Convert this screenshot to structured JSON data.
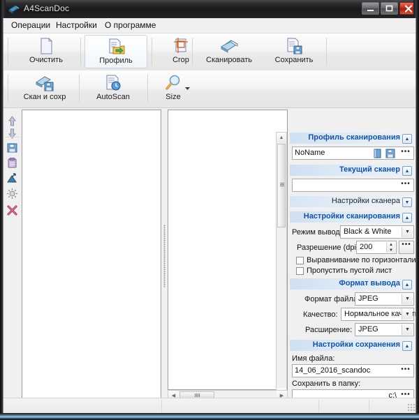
{
  "window": {
    "title": "A4ScanDoc",
    "app_icon": "scanner-icon",
    "buttons": {
      "minimize": "–",
      "maximize": "□",
      "close": "✕"
    }
  },
  "menubar": {
    "items": [
      {
        "label": "Операции",
        "name": "menu-operations"
      },
      {
        "label": "Настройки",
        "name": "menu-settings"
      },
      {
        "label": "О программе",
        "name": "menu-about"
      }
    ]
  },
  "toolbar_top": {
    "buttons": [
      {
        "label": "Очистить",
        "icon": "blank-page-icon",
        "framed": false
      },
      {
        "label": "Профиль",
        "icon": "profile-folder-icon",
        "framed": true
      },
      {
        "label": "Crop",
        "icon": "crop-icon",
        "framed": false
      },
      {
        "label": "Сканировать",
        "icon": "scanner-icon",
        "framed": false
      },
      {
        "label": "Сохранить",
        "icon": "save-document-icon",
        "framed": false
      }
    ]
  },
  "toolbar_bottom": {
    "buttons": [
      {
        "label": "Скан и сохр",
        "icon": "scan-and-save-icon",
        "framed": false
      },
      {
        "label": "AutoScan",
        "icon": "autoscan-icon",
        "framed": false
      },
      {
        "label": "Size",
        "icon": "magnifier-icon",
        "framed": false
      }
    ],
    "dropdown_arrow": "▼"
  },
  "left_tools": {
    "buttons": [
      {
        "name": "move-up-button",
        "icon": "arrow-up-icon"
      },
      {
        "name": "move-down-button",
        "icon": "arrow-down-icon"
      },
      {
        "name": "save-page-button",
        "icon": "floppy-icon"
      },
      {
        "name": "copy-clipboard-button",
        "icon": "clipboard-icon"
      },
      {
        "name": "rotate-button",
        "icon": "rotate-icon"
      },
      {
        "name": "brightness-button",
        "icon": "brightness-icon"
      },
      {
        "name": "delete-button",
        "icon": "delete-x-icon"
      }
    ]
  },
  "thumb_toolbar": {
    "buttons": [
      {
        "name": "select-all-button",
        "icon": "checked-box-icon"
      },
      {
        "name": "deselect-all-button",
        "icon": "empty-box-icon"
      },
      {
        "name": "thumbnail-grid-button",
        "icon": "grid-icon"
      }
    ]
  },
  "preview_toolbar": {
    "buttons": [
      {
        "name": "fit-page-button",
        "icon": "fit-page-icon"
      },
      {
        "name": "fit-left-half-button",
        "icon": "fit-left-half-icon"
      },
      {
        "name": "fit-right-half-button",
        "icon": "fit-right-half-icon"
      },
      {
        "name": "fit-width-button",
        "icon": "fit-width-icon"
      },
      {
        "name": "zoom-actual-button",
        "icon": "zoom-actual-icon"
      },
      {
        "name": "zoom-fit-button",
        "icon": "zoom-fit-icon"
      }
    ]
  },
  "scrollbars": {
    "up_arrow": "▲",
    "down_arrow": "▼",
    "left_arrow": "◀",
    "right_arrow": "▶"
  },
  "right_panel": {
    "profile_section": {
      "title": "Профиль сканирования",
      "toggle": "▲",
      "value": "NoName",
      "open_icon": "open-profile-icon",
      "save_icon": "save-profile-icon",
      "browse": "•••"
    },
    "scanner_section": {
      "title": "Текущий сканер",
      "toggle": "▲",
      "value": "",
      "browse": "•••"
    },
    "scanner_settings_section": {
      "title": "Настройки сканера",
      "toggle": "▼"
    },
    "scan_settings_section": {
      "title": "Настройки сканирования",
      "toggle": "▲",
      "mode_label": "Режим вывода:",
      "mode_value": "Black & White",
      "dpi_label": "Разрешение (dpi):",
      "dpi_value": "200",
      "dpi_browse": "•••",
      "check_align_label": "Выравнивание по горизонтали",
      "check_align_checked": false,
      "check_skip_label": "Пропустить пустой лист",
      "check_skip_checked": false
    },
    "output_section": {
      "title": "Формат вывода",
      "toggle": "▲",
      "file_format_label": "Формат файла:",
      "file_format_value": "JPEG",
      "quality_label": "Качество:",
      "quality_value": "Нормальное качество",
      "extension_label": "Расширение:",
      "extension_value": "JPEG"
    },
    "save_section": {
      "title": "Настройки сохранения",
      "toggle": "▲",
      "filename_label": "Имя файла:",
      "filename_value": "14_06_2016_scandoc",
      "filename_browse": "•••",
      "folder_label": "Сохранить в папку:",
      "folder_value": "c:\\",
      "folder_browse": "•••"
    }
  },
  "statusbar": {
    "cells": [
      "",
      "",
      "",
      ""
    ],
    "grip": "resize-grip"
  },
  "colors": {
    "accent": "#15539e",
    "section_header": "#cfe0f2",
    "close_button": "#c02a19",
    "panel_bg": "#f0f0f0"
  }
}
